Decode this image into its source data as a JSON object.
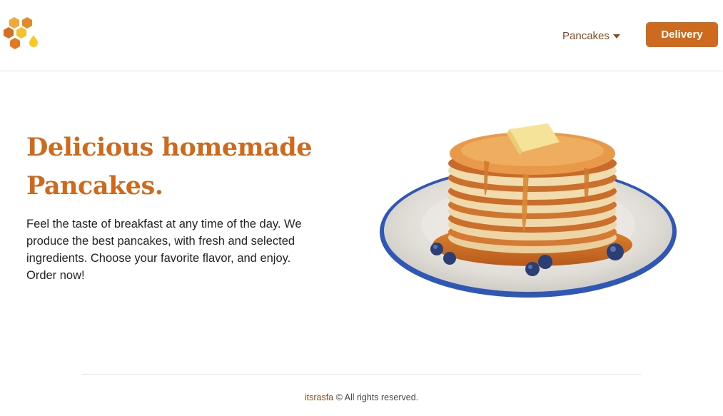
{
  "header": {
    "logo_icon": "honeycomb-icon",
    "nav": {
      "dropdown_label": "Pancakes",
      "dropdown_icon": "caret-down-icon"
    },
    "delivery_label": "Delivery"
  },
  "hero": {
    "title_line1": "Delicious homemade",
    "title_line2": "Pancakes.",
    "description": "Feel the taste of breakfast at any time of the day. We produce the best pancakes, with fresh and selected ingredients. Choose your favorite flavor, and enjoy. Order now!",
    "illustration": "pancake-stack-illustration"
  },
  "footer": {
    "author": "itsrasfa",
    "rights": "© All rights reserved."
  },
  "colors": {
    "accent": "#cd6a1e",
    "nav_text": "#8a4b1f",
    "honey": "#f5c12e"
  }
}
